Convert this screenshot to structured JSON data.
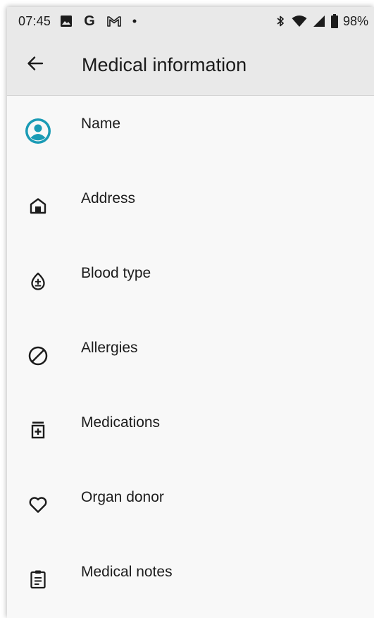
{
  "status_bar": {
    "time": "07:45",
    "battery_percent": "98%",
    "left_icons": [
      "gallery-icon",
      "google-g-icon",
      "gmail-icon",
      "dot-icon"
    ],
    "right_icons": [
      "bluetooth-icon",
      "wifi-icon",
      "cell-signal-icon",
      "battery-icon"
    ]
  },
  "app_bar": {
    "title": "Medical information",
    "back_icon": "arrow-back-icon"
  },
  "accent_color": "#1a9bb5",
  "items": [
    {
      "label": "Name",
      "value": "",
      "icon": "account-circle-icon"
    },
    {
      "label": "Address",
      "value": "",
      "icon": "home-icon"
    },
    {
      "label": "Blood type",
      "value": "",
      "icon": "blood-drop-icon"
    },
    {
      "label": "Allergies",
      "value": "",
      "icon": "block-icon"
    },
    {
      "label": "Medications",
      "value": "",
      "icon": "medication-icon"
    },
    {
      "label": "Organ donor",
      "value": "",
      "icon": "heart-icon"
    },
    {
      "label": "Medical notes",
      "value": "",
      "icon": "clipboard-icon"
    }
  ]
}
